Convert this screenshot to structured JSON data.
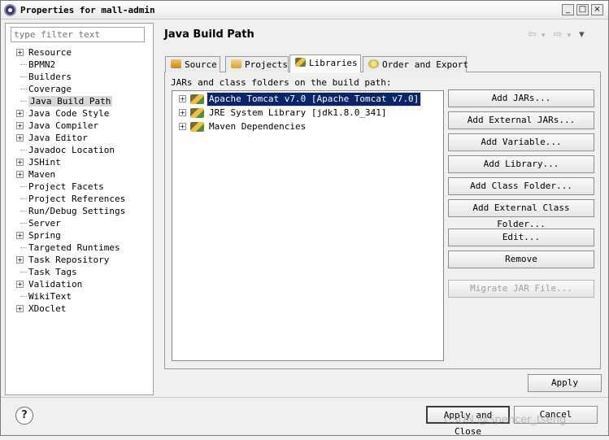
{
  "window": {
    "title": "Properties for mall-admin",
    "buttons": [
      "_",
      "□",
      "×"
    ]
  },
  "left": {
    "filter_placeholder": "type filter text",
    "items": [
      {
        "label": "Resource",
        "expandable": true
      },
      {
        "label": "BPMN2",
        "expandable": false
      },
      {
        "label": "Builders",
        "expandable": false
      },
      {
        "label": "Coverage",
        "expandable": false
      },
      {
        "label": "Java Build Path",
        "expandable": false,
        "selected": true
      },
      {
        "label": "Java Code Style",
        "expandable": true
      },
      {
        "label": "Java Compiler",
        "expandable": true
      },
      {
        "label": "Java Editor",
        "expandable": true
      },
      {
        "label": "Javadoc Location",
        "expandable": false
      },
      {
        "label": "JSHint",
        "expandable": true
      },
      {
        "label": "Maven",
        "expandable": true
      },
      {
        "label": "Project Facets",
        "expandable": false
      },
      {
        "label": "Project References",
        "expandable": false
      },
      {
        "label": "Run/Debug Settings",
        "expandable": false
      },
      {
        "label": "Server",
        "expandable": false
      },
      {
        "label": "Spring",
        "expandable": true
      },
      {
        "label": "Targeted Runtimes",
        "expandable": false
      },
      {
        "label": "Task Repository",
        "expandable": true
      },
      {
        "label": "Task Tags",
        "expandable": false
      },
      {
        "label": "Validation",
        "expandable": true
      },
      {
        "label": "WikiText",
        "expandable": false
      },
      {
        "label": "XDoclet",
        "expandable": true
      }
    ]
  },
  "main": {
    "title": "Java Build Path",
    "nav": {
      "back": "⇦",
      "back_menu": "▾",
      "forward": "⇨",
      "forward_menu": "▾",
      "view_menu": "▾"
    },
    "tabs": [
      {
        "label": "Source"
      },
      {
        "label": "Projects"
      },
      {
        "label": "Libraries",
        "active": true
      },
      {
        "label": "Order and Export"
      }
    ],
    "section_label": "JARs and class folders on the build path:",
    "libraries": [
      {
        "label": "Apache Tomcat v7.0 [Apache Tomcat v7.0]",
        "selected": true
      },
      {
        "label": "JRE System Library [jdk1.8.0_341]",
        "selected": false
      },
      {
        "label": "Maven Dependencies",
        "selected": false
      }
    ],
    "buttons": {
      "add_jars": "Add JARs...",
      "add_external_jars": "Add External JARs...",
      "add_variable": "Add Variable...",
      "add_library": "Add Library...",
      "add_class_folder": "Add Class Folder...",
      "add_external_class_folder": "Add External Class Folder...",
      "edit": "Edit...",
      "remove": "Remove",
      "migrate_jar": "Migrate JAR File..."
    },
    "apply": "Apply"
  },
  "footer": {
    "help": "?",
    "apply_and_close": "Apply and Close",
    "cancel": "Cancel",
    "watermark": "CSDN @Spencer_tseng"
  }
}
